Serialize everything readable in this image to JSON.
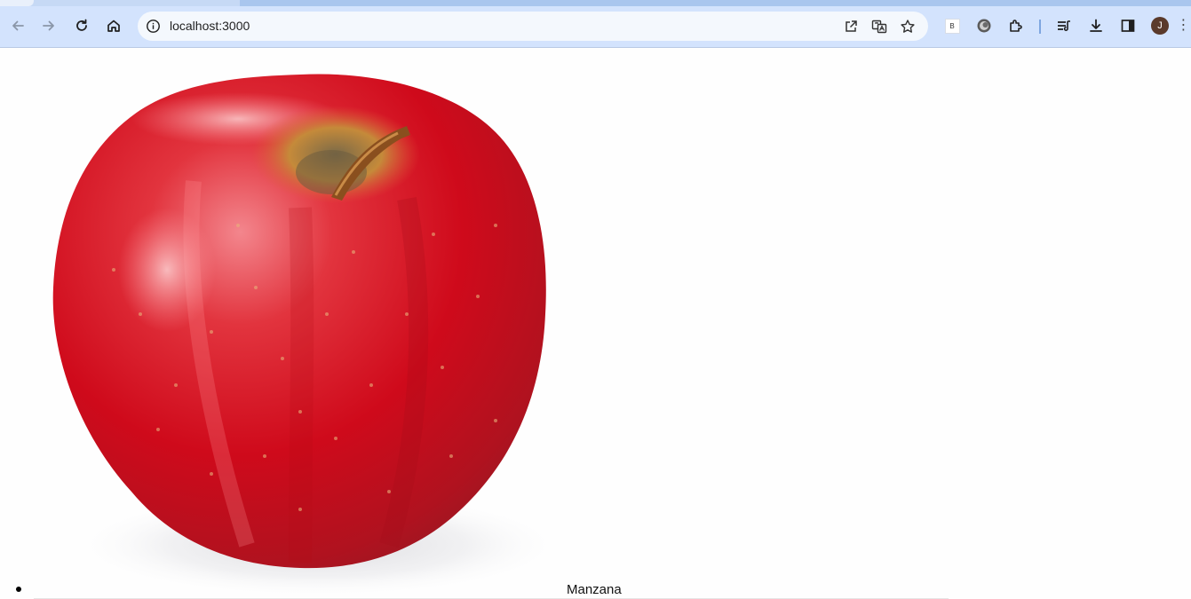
{
  "browser": {
    "address_bar": {
      "url": "localhost:3000"
    },
    "toolbar_icons": [
      "back-arrow-icon",
      "forward-arrow-icon",
      "reload-icon",
      "home-icon",
      "site-info-icon",
      "open-in-app-icon",
      "translate-icon",
      "bookmark-star-icon",
      "extension-b-icon",
      "extension-globe-icon",
      "extensions-puzzle-icon",
      "media-queue-icon",
      "downloads-icon",
      "side-panel-icon",
      "profile-avatar",
      "more-menu-icon"
    ],
    "extension_badge": "B",
    "profile_initial": "J",
    "accent_color": "#d3e3fd"
  },
  "products": [
    {
      "name": "Manzana",
      "image": "red-apple-photo"
    }
  ]
}
